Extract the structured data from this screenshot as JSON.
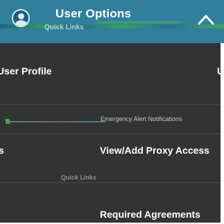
{
  "header": {
    "title": "User Options",
    "ghost_text": "Quick Links",
    "toggle_icon": "chevron-up-icon",
    "avatar_icon": "user-avatar-icon",
    "background_color": "#2f7f9d"
  },
  "menu": {
    "background_color": "#333333",
    "items": [
      {
        "label": "User Profile"
      },
      {
        "label": "U"
      },
      {
        "label": "Emergency Alert Notifications"
      },
      {
        "label": "s"
      },
      {
        "label": "View/Add Proxy Access"
      },
      {
        "label": "Required Agreements"
      }
    ],
    "ghost_text": "Quick Links"
  }
}
